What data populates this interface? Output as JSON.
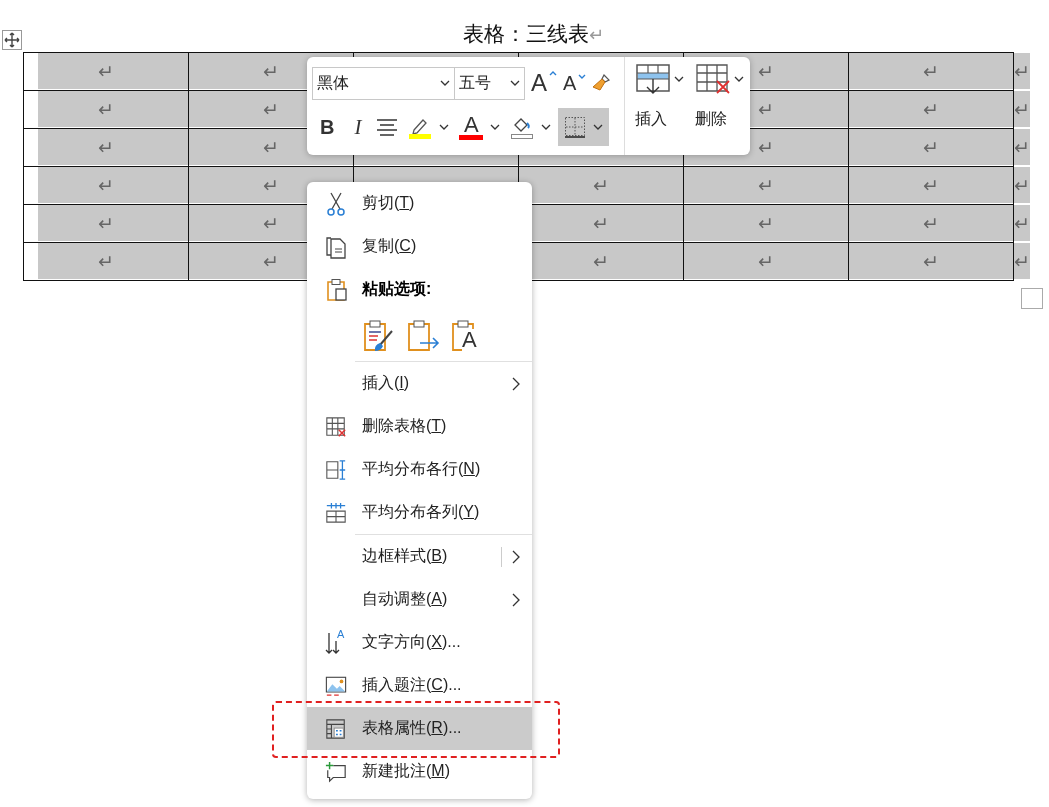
{
  "document": {
    "title": "表格：三线表",
    "title_mark": "↵"
  },
  "table": {
    "rows": [
      {
        "cells": [
          "↵",
          "↵",
          null,
          null,
          "↵",
          "↵"
        ],
        "end_mark": "↵"
      },
      {
        "cells": [
          "↵",
          "↵",
          null,
          null,
          "↵",
          "↵"
        ],
        "end_mark": "↵"
      },
      {
        "cells": [
          "↵",
          "↵",
          null,
          null,
          "↵",
          "↵"
        ],
        "end_mark": "↵"
      },
      {
        "cells": [
          "↵",
          "↵",
          null,
          "↵",
          "↵",
          "↵"
        ],
        "end_mark": "↵"
      },
      {
        "cells": [
          "↵",
          "↵",
          null,
          "↵",
          "↵",
          "↵"
        ],
        "end_mark": "↵"
      },
      {
        "cells": [
          "↵",
          "↵",
          null,
          "↵",
          "↵",
          "↵"
        ],
        "end_mark": "↵"
      }
    ]
  },
  "toolbar": {
    "font": {
      "value": "黑体"
    },
    "size": {
      "value": "五号"
    },
    "row1_buttons": [
      {
        "kind": "grow-font",
        "glyph": "A"
      },
      {
        "kind": "shrink-font",
        "glyph": "A"
      },
      {
        "kind": "format-painter"
      }
    ],
    "row2_buttons": [
      {
        "kind": "bold",
        "glyph": "B",
        "pressed": false
      },
      {
        "kind": "italic",
        "glyph": "I",
        "pressed": false
      },
      {
        "kind": "align",
        "pressed": false
      },
      {
        "kind": "highlight",
        "color": "#ffff00",
        "pressed": false
      },
      {
        "kind": "font-color",
        "glyph": "A",
        "color": "#ff0000",
        "pressed": false
      },
      {
        "kind": "shading",
        "pressed": false
      },
      {
        "kind": "borders",
        "pressed": true
      }
    ],
    "table_buttons": [
      {
        "kind": "insert",
        "label": "插入"
      },
      {
        "kind": "delete",
        "label": "删除"
      }
    ]
  },
  "context_menu": {
    "items": [
      {
        "kind": "cut",
        "before": "剪切(",
        "key": "T",
        "after": ")",
        "submenu": false,
        "selected": false
      },
      {
        "kind": "copy",
        "before": "复制(",
        "key": "C",
        "after": ")",
        "submenu": false,
        "selected": false
      },
      {
        "kind": "paste-heading",
        "text": "粘贴选项:"
      },
      {
        "kind": "paste-options",
        "glyph": "A"
      },
      {
        "kind": "insert",
        "before": "插入(",
        "key": "I",
        "after": ")",
        "submenu": true,
        "divider_before": true,
        "selected": false
      },
      {
        "kind": "delete-table",
        "before": "删除表格(",
        "key": "T",
        "after": ")",
        "submenu": false,
        "selected": false
      },
      {
        "kind": "distribute-rows",
        "before": "平均分布各行(",
        "key": "N",
        "after": ")",
        "submenu": false,
        "selected": false
      },
      {
        "kind": "distribute-columns",
        "before": "平均分布各列(",
        "key": "Y",
        "after": ")",
        "submenu": false,
        "selected": false
      },
      {
        "kind": "border-styles",
        "before": "边框样式(",
        "key": "B",
        "after": ")",
        "submenu": true,
        "split": true,
        "divider_before": true,
        "selected": false
      },
      {
        "kind": "autofit",
        "before": "自动调整(",
        "key": "A",
        "after": ")",
        "submenu": true,
        "selected": false
      },
      {
        "kind": "text-direction",
        "glyph": "A",
        "before": "文字方向(",
        "key": "X",
        "after": ")...",
        "submenu": false,
        "selected": false
      },
      {
        "kind": "insert-caption",
        "before": "插入题注(",
        "key": "C",
        "after": ")...",
        "submenu": false,
        "selected": false
      },
      {
        "kind": "table-properties",
        "before": "表格属性(",
        "key": "R",
        "after": ")...",
        "submenu": false,
        "selected": true,
        "annotated": true
      },
      {
        "kind": "new-comment",
        "before": "新建批注(",
        "key": "M",
        "after": ")",
        "submenu": false,
        "selected": false
      }
    ]
  }
}
